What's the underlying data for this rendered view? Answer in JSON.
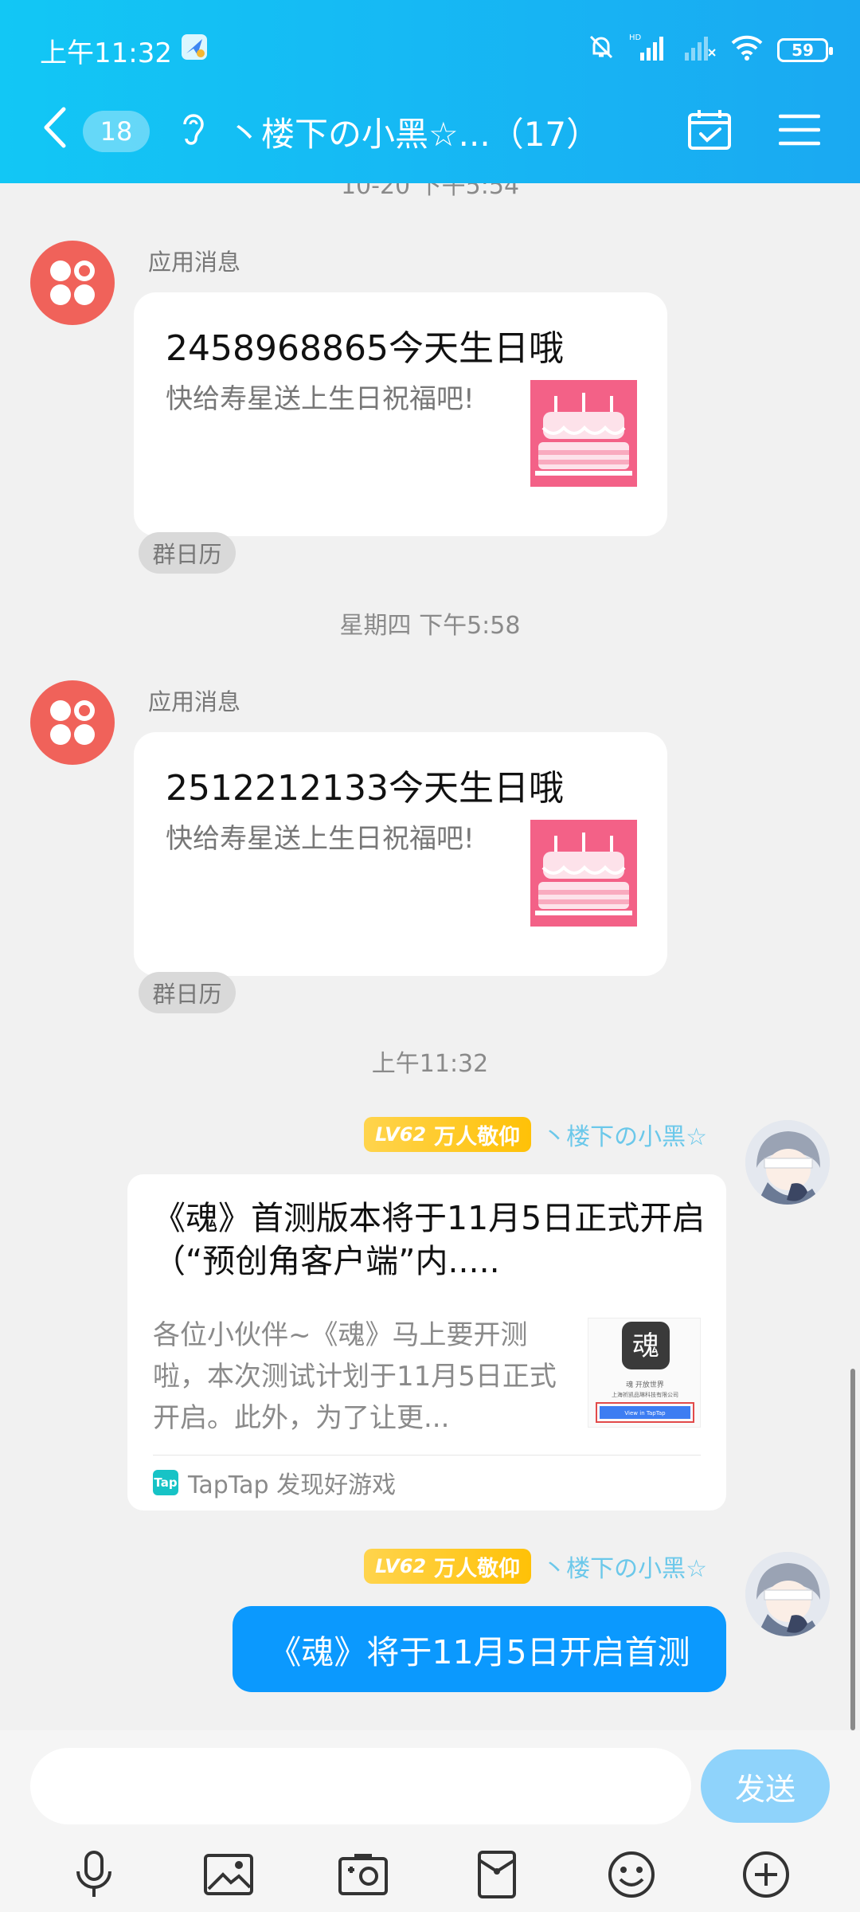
{
  "status": {
    "time": "上午11:32",
    "battery": "59",
    "hd": "HD"
  },
  "header": {
    "back_label": "‹",
    "unread_count": "18",
    "title": "丶楼下の小黑☆...（17）"
  },
  "timestamps": {
    "top_partial": "10-20 下午5:54",
    "thursday": "星期四 下午5:58",
    "now": "上午11:32"
  },
  "messages": [
    {
      "sender": "应用消息",
      "title": "2458968865今天生日哦",
      "subtitle": "快给寿星送上生日祝福吧!",
      "tag": "群日历"
    },
    {
      "sender": "应用消息",
      "title": "2512212133今天生日哦",
      "subtitle": "快给寿星送上生日祝福吧!",
      "tag": "群日历"
    }
  ],
  "user": {
    "level": "LV62",
    "title": "万人敬仰",
    "name": "丶楼下の小黑☆"
  },
  "link_card": {
    "title": "《魂》首测版本将于11月5日正式开启（“预创角客户端”内.....",
    "description": "各位小伙伴~《魂》马上要开测啦，本次测试计划于11月5日正式开启。此外，为了让更...",
    "thumb_title": "魂",
    "thumb_caption": "魂 开放世界",
    "thumb_company": "上海祈凯品琳科技有限公司",
    "thumb_button": "View in TapTap",
    "source_logo": "Tap",
    "source": "TapTap 发现好游戏"
  },
  "bubble": {
    "text": "《魂》将于11月5日开启首测"
  },
  "input": {
    "placeholder": "",
    "send_label": "发送"
  },
  "colors": {
    "header_start": "#12c7f5",
    "header_end": "#1aa9f2",
    "bubble": "#0b99fe",
    "app_avatar": "#f0625a",
    "cake": "#f36187",
    "level": "#ffc107",
    "username": "#6bc8ea"
  }
}
